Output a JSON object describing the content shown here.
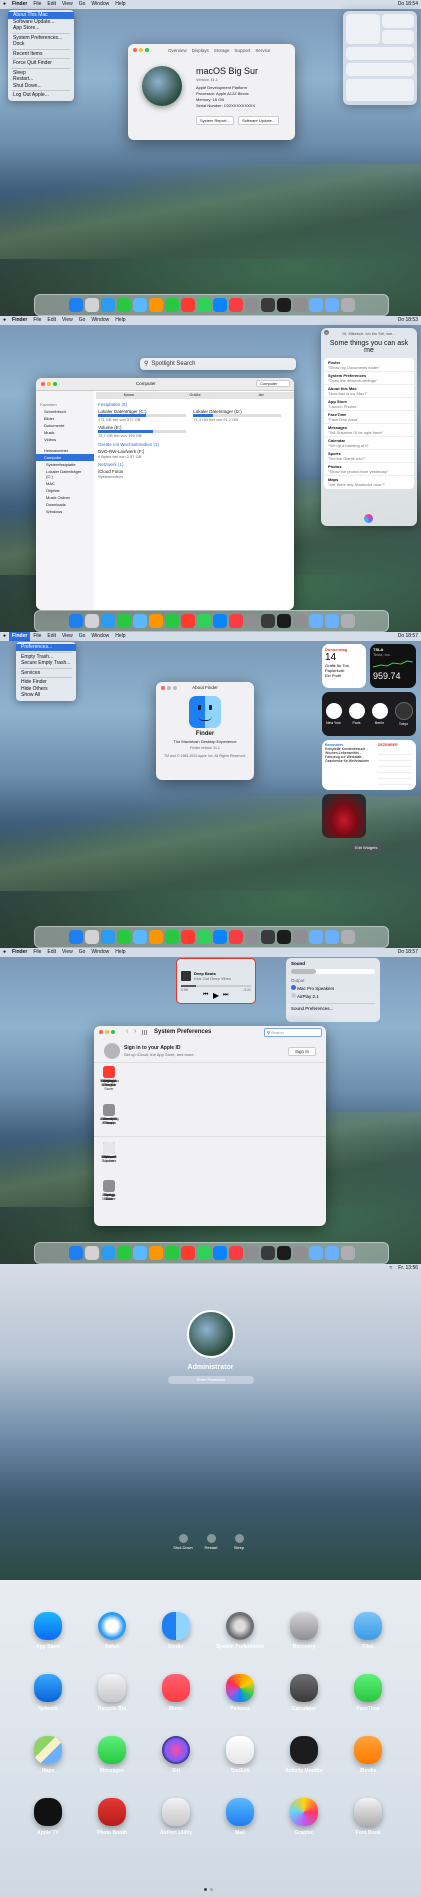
{
  "menubar": {
    "items": [
      "Finder",
      "File",
      "Edit",
      "View",
      "Go",
      "Window",
      "Help"
    ],
    "clock": "Do 18:54",
    "clock2": "Do 18:53",
    "clock3": "Do 18:57",
    "clock4": "Do 18:57",
    "clock5": "Fr. 13:56"
  },
  "apple_menu": {
    "items": [
      "About This Mac",
      "Software Update...",
      "App Store...",
      "System Preferences...",
      "Dock",
      "Recent Items",
      "Force Quit Finder",
      "Sleep",
      "Restart...",
      "Shut Down...",
      "Log Out Apple..."
    ]
  },
  "finder_menu": {
    "items": [
      "Preferences...",
      "Empty Trash...",
      "Secure Empty Trash...",
      "Services",
      "Hide Finder",
      "Hide Others",
      "Show All"
    ]
  },
  "about_mac": {
    "tabs": [
      "Overview",
      "Displays",
      "Storage",
      "Support",
      "Service"
    ],
    "os_name": "macOS Big Sur",
    "version": "Version 11.1",
    "lines": [
      "Apple Development Platform",
      "Processor: Apple A12Z Bionic",
      "Memory: 16 GB",
      "Serial Number: C02XXXXXXXXX"
    ],
    "buttons": [
      "System Report...",
      "Software Update..."
    ]
  },
  "spotlight": {
    "placeholder": "Spotlight Search"
  },
  "finder": {
    "path": "Computer",
    "search_placeholder": "Computer",
    "columns": [
      "Name",
      "Größe",
      "Art"
    ],
    "sidebar": [
      "Favoriten",
      "Schreibtisch",
      "Bilder",
      "Dokumente",
      "Musik",
      "Videos",
      "Heimatordner",
      "Computer",
      "Systemfestplatte",
      "Lokaler Datenträger (C:)",
      "MAC",
      "Objekte",
      "Musik Ordner",
      "Downloads",
      "Windows"
    ],
    "groups": [
      "Festplatten (5)",
      "Geräte mit Wechselmedien (1)",
      "Netzwerk (1)"
    ],
    "drives": [
      {
        "name": "Lokaler Datenträger (C:)",
        "free": "171 GB frei von 372 GB"
      },
      {
        "name": "Lokaler Datenträger (D:)",
        "free": "71,3 GB frei von 91,2 GB"
      },
      {
        "name": "Volume (E:)",
        "free": "75,7 GB frei von 199 GB"
      }
    ],
    "removable": {
      "name": "DVD-RW-Laufwerk (F:)",
      "free": "0 Bytes frei von 2,37 GB"
    },
    "network": {
      "name": "iCloud Fotos",
      "sub": "Systemordner"
    }
  },
  "siri": {
    "header": "Hi, Mikesch. Ich bin Siri, wie...",
    "headline": "Some things you can ask me",
    "items": [
      {
        "title": "Finder",
        "sub": "\"Show my Documents folder\""
      },
      {
        "title": "System Preferences",
        "sub": "\"Open the network settings\""
      },
      {
        "title": "About this Mac",
        "sub": "\"How fast is my Mac?\""
      },
      {
        "title": "App Store",
        "sub": "\"Launch Photos\""
      },
      {
        "title": "FaceTime",
        "sub": "\"FaceTime Anna\""
      },
      {
        "title": "Messages",
        "sub": "\"Tell Susanne I'll be right there\""
      },
      {
        "title": "Calendar",
        "sub": "\"Set up a meeting at 9\""
      },
      {
        "title": "Sports",
        "sub": "\"Did the Giants win?\""
      },
      {
        "title": "Photos",
        "sub": "\"Show the photos from yesterday\""
      },
      {
        "title": "Maps",
        "sub": "\"Are there any Starbucks near?\""
      }
    ]
  },
  "about_finder": {
    "title": "About Finder",
    "name": "Finder",
    "subtitle": "The Macintosh Desktop Experience",
    "version": "Finder version 11.1",
    "copyright": "TM and © 1983-2020 Apple Inc. All Rights Reserved."
  },
  "widgets": {
    "calendar_day": "Donnerstag",
    "calendar_date": "14",
    "calendar_events": [
      "Grafik für Ton",
      "Papierkorb",
      "Ein Profil"
    ],
    "stock_symbol": "TSLA",
    "stock_name": "Tesla, Inc.",
    "stock_price": "959.74",
    "clocks": [
      "New York",
      "Paris",
      "Berlin",
      "Tokyo"
    ],
    "reminders_title": "Reminders",
    "reminders": [
      "Komplette Kundenbesuch...",
      "Wochen-Lebensmittel...",
      "Fahrzeug zur Werkstatt...",
      "Geschenke für Weihnachten"
    ],
    "month": "DEZEMBER",
    "edit_widgets": "Edit Widgets"
  },
  "music": {
    "track": "Deep Beats",
    "artist": "Kick Out Deep Vibes",
    "elapsed": "0:58",
    "remaining": "-3:21"
  },
  "sound": {
    "title": "Sound",
    "output": "Output",
    "devices": [
      "Mac Pro Speakers",
      "AirPlay 2.1"
    ],
    "prefs": "Sound Preferences..."
  },
  "sysprefs": {
    "title": "System Preferences",
    "search_placeholder": "Search",
    "signin_title": "Sign in to your Apple ID",
    "signin_sub": "Set up iCloud, the App Store, and more.",
    "signin_button": "Sign In",
    "rows": [
      [
        "General",
        "Desktop & Screen Saver",
        "Dock & Menu Bar",
        "Mission Control",
        "Siri",
        "Spotlight",
        "Language & Region",
        "Notifications"
      ],
      [
        "Internet Accounts",
        "Users & Groups",
        "Accessibility",
        "Screen Time",
        "Extensions",
        "Security & Privacy"
      ],
      [
        "Software Update",
        "Network",
        "Bluetooth",
        "Sound",
        "Printers & Scanners",
        "Keyboard",
        "Trackpad",
        "Mouse"
      ],
      [
        "Displays",
        "Energy Saver",
        "Date & Time",
        "Sharing",
        "Time Machine",
        "Startup Disk"
      ]
    ]
  },
  "login": {
    "user": "Administrator",
    "placeholder": "Enter Password",
    "buttons": [
      "Shut Down",
      "Restart",
      "Sleep"
    ]
  },
  "launchpad": {
    "apps": [
      [
        "App Store",
        "Safari",
        "Finder",
        "System Preferences",
        "Recovery",
        "Files"
      ],
      [
        "Network",
        "Recycle Bin",
        "Music",
        "Pictures",
        "Calculator",
        "FaceTime"
      ],
      [
        "Maps",
        "Messages",
        "Siri",
        "TextEdit",
        "Activity Monitor",
        "iBooks"
      ],
      [
        "Apple TV",
        "Photo Booth",
        "AirPort Utility",
        "Mail",
        "Graphic",
        "Font Book"
      ]
    ]
  },
  "colors": {
    "accent": "#2f6fde",
    "close": "#fe5f57",
    "minimize": "#febc2e",
    "maximize": "#28c840"
  }
}
